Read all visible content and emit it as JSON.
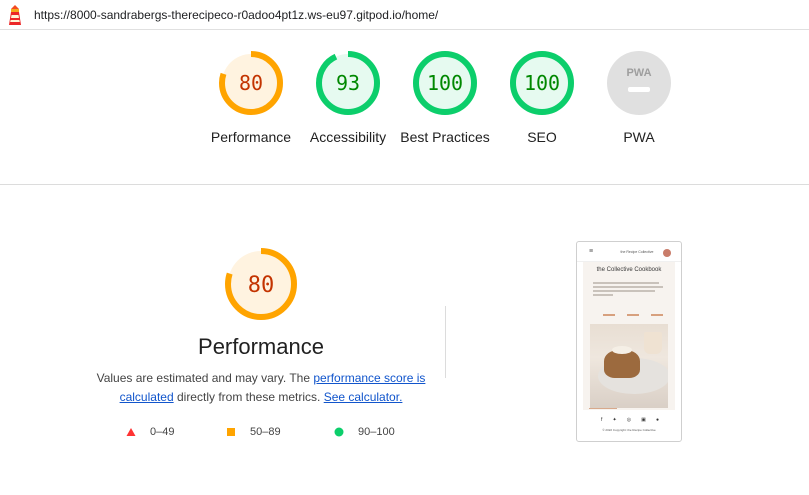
{
  "browser": {
    "url": "https://8000-sandrabergs-therecipeco-r0adoo4pt1z.ws-eu97.gitpod.io/home/"
  },
  "colors": {
    "average": "#ffa400",
    "average_text": "#c33300",
    "average_fill": "#fff3e0",
    "pass": "#0cce6b",
    "pass_text": "#008800",
    "pass_fill": "#e6faf0",
    "fail": "#ff3333",
    "pwa_gray": "#e0e0e0"
  },
  "gauges": [
    {
      "label": "Performance",
      "score": "80",
      "percent": 80,
      "rating": "average"
    },
    {
      "label": "Accessibility",
      "score": "93",
      "percent": 93,
      "rating": "pass"
    },
    {
      "label": "Best Practices",
      "score": "100",
      "percent": 100,
      "rating": "pass"
    },
    {
      "label": "SEO",
      "score": "100",
      "percent": 100,
      "rating": "pass"
    },
    {
      "label": "PWA",
      "score": "",
      "percent": 0,
      "rating": "pwa",
      "badge_text": "PWA"
    }
  ],
  "performance": {
    "score": "80",
    "percent": 80,
    "title": "Performance",
    "desc_prefix": "Values are estimated and may vary. The ",
    "link_score": "performance score is calculated",
    "desc_middle": " directly from these metrics. ",
    "link_calculator": "See calculator."
  },
  "legend": [
    {
      "range": "0–49",
      "shape": "triangle",
      "rating": "fail"
    },
    {
      "range": "50–89",
      "shape": "square",
      "rating": "average"
    },
    {
      "range": "90–100",
      "shape": "circle",
      "rating": "pass"
    }
  ],
  "screenshot": {
    "brand": "the Recipe Collective",
    "title": "the Collective Cookbook",
    "copyright": "© 2022 Copyright: the Recipe Collective"
  }
}
